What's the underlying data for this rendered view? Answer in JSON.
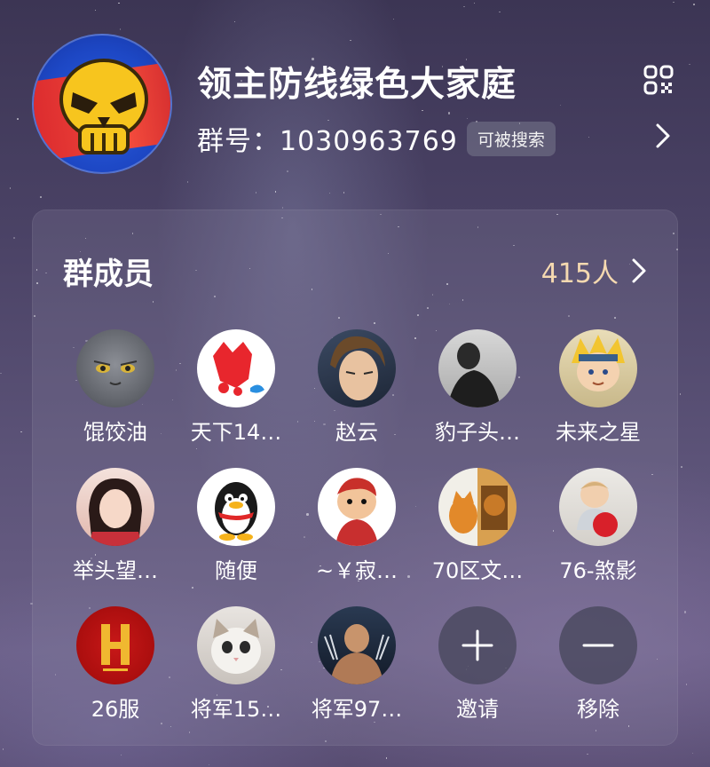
{
  "group": {
    "name": "领主防线绿色大家庭",
    "id_text": "群号：1030963769",
    "searchable_label": "可被搜索"
  },
  "members_section": {
    "title": "群成员",
    "count": "415人"
  },
  "members": [
    {
      "name": "馄饺油",
      "avatar": "grey-cat-avatar"
    },
    {
      "name": "天下14…",
      "avatar": "red-mascot-avatar"
    },
    {
      "name": "赵云",
      "avatar": "anime-warrior-avatar"
    },
    {
      "name": "豹子头…",
      "avatar": "photo-man-avatar"
    },
    {
      "name": "未来之星",
      "avatar": "ninja-kid-avatar"
    },
    {
      "name": "举头望…",
      "avatar": "cosplay-girl-avatar"
    },
    {
      "name": "随便",
      "avatar": "qq-penguin-avatar"
    },
    {
      "name": "~￥寂…",
      "avatar": "cartoon-player-avatar"
    },
    {
      "name": "70区文…",
      "avatar": "cat-lion-avatar"
    },
    {
      "name": "76-煞影",
      "avatar": "baby-avatar"
    },
    {
      "name": "26服",
      "avatar": "red-h-logo-avatar"
    },
    {
      "name": "将军15…",
      "avatar": "kitten-avatar"
    },
    {
      "name": "将军97…",
      "avatar": "wolverine-avatar"
    }
  ],
  "actions": {
    "invite_label": "邀请",
    "remove_label": "移除"
  },
  "colors": {
    "member_count": "#f5d9b0",
    "card_bg": "rgba(140,135,165,0.22)"
  }
}
